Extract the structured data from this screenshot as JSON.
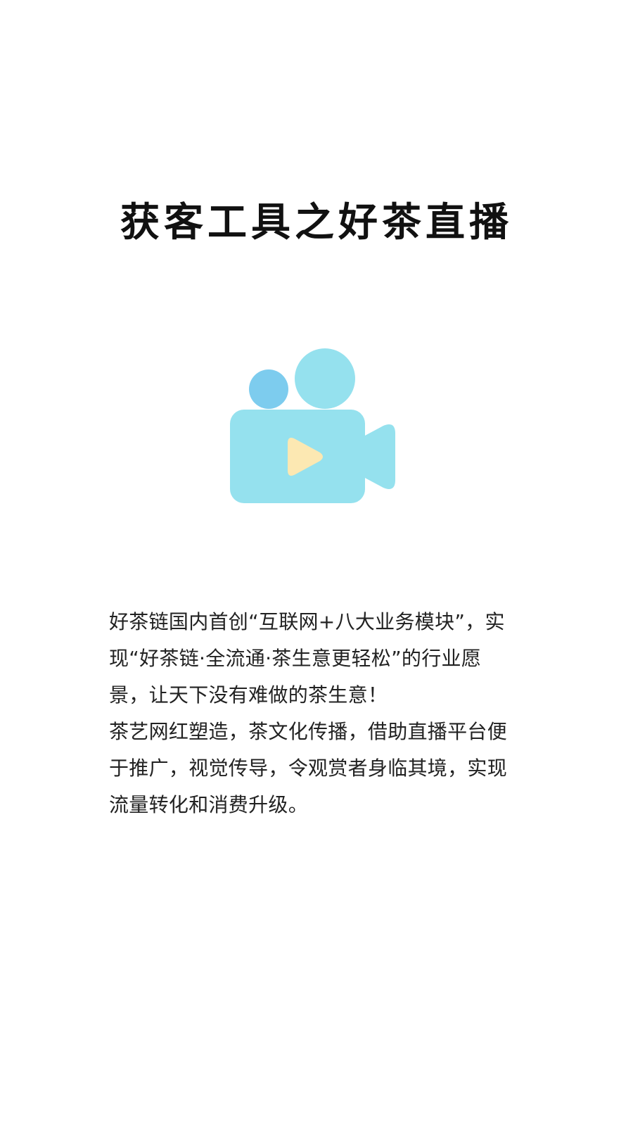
{
  "page": {
    "title": "获客工具之好茶直播"
  },
  "hero": {
    "icon": "video-camera-play-icon",
    "colors": {
      "camera_body": "#95E1EE",
      "small_reel": "#7DCCEE",
      "play_triangle": "#FCE8B2"
    }
  },
  "description": {
    "paragraph_1": "好茶链国内首创“互联网+八大业务模块”，实现“好茶链·全流通·茶生意更轻松”的行业愿景，让天下没有难做的茶生意！",
    "paragraph_2": "茶艺网红塑造，茶文化传播，借助直播平台便于推广，视觉传导，令观赏者身临其境，实现流量转化和消费升级。"
  }
}
